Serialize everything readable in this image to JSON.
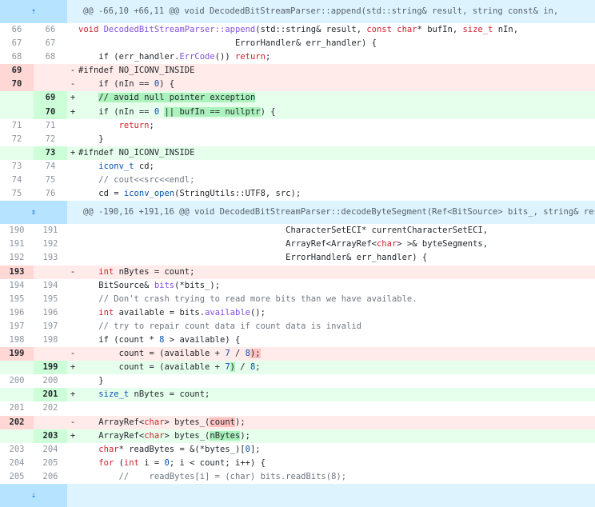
{
  "hunks": [
    {
      "expander_icon": "expand-up-icon",
      "header": "@@ -66,10 +66,11 @@ void DecodedBitStreamParser::append(std::string& result, string const& in,"
    },
    {
      "expander_icon": "expand-both-icon",
      "header": "@@ -190,16 +191,16 @@ void DecodedBitStreamParser::decodeByteSegment(Ref<BitSource> bits_, string& res"
    }
  ],
  "lines": {
    "l1": {
      "old": "66",
      "new": "66",
      "mark": " "
    },
    "l2": {
      "old": "67",
      "new": "67",
      "mark": " "
    },
    "l3": {
      "old": "68",
      "new": "68",
      "mark": " "
    },
    "l4": {
      "old": "69",
      "new": "",
      "mark": "-"
    },
    "l5": {
      "old": "70",
      "new": "",
      "mark": "-"
    },
    "l6": {
      "old": "",
      "new": "69",
      "mark": "+"
    },
    "l7": {
      "old": "",
      "new": "70",
      "mark": "+"
    },
    "l8": {
      "old": "71",
      "new": "71",
      "mark": " "
    },
    "l9": {
      "old": "72",
      "new": "72",
      "mark": " "
    },
    "l10": {
      "old": "",
      "new": "73",
      "mark": "+"
    },
    "l11": {
      "old": "73",
      "new": "74",
      "mark": " "
    },
    "l12": {
      "old": "74",
      "new": "75",
      "mark": " "
    },
    "l13": {
      "old": "75",
      "new": "76",
      "mark": " "
    },
    "m1": {
      "old": "190",
      "new": "191",
      "mark": " "
    },
    "m2": {
      "old": "191",
      "new": "192",
      "mark": " "
    },
    "m3": {
      "old": "192",
      "new": "193",
      "mark": " "
    },
    "m4": {
      "old": "193",
      "new": "",
      "mark": "-"
    },
    "m5": {
      "old": "194",
      "new": "194",
      "mark": " "
    },
    "m6": {
      "old": "195",
      "new": "195",
      "mark": " "
    },
    "m7": {
      "old": "196",
      "new": "196",
      "mark": " "
    },
    "m8": {
      "old": "197",
      "new": "197",
      "mark": " "
    },
    "m9": {
      "old": "198",
      "new": "198",
      "mark": " "
    },
    "m10": {
      "old": "199",
      "new": "",
      "mark": "-"
    },
    "m11": {
      "old": "",
      "new": "199",
      "mark": "+"
    },
    "m12": {
      "old": "200",
      "new": "200",
      "mark": " "
    },
    "m13": {
      "old": "",
      "new": "201",
      "mark": "+"
    },
    "m14": {
      "old": "201",
      "new": "202",
      "mark": " "
    },
    "m15": {
      "old": "202",
      "new": "",
      "mark": "-"
    },
    "m16": {
      "old": "",
      "new": "203",
      "mark": "+"
    },
    "m17": {
      "old": "203",
      "new": "204",
      "mark": " "
    },
    "m18": {
      "old": "204",
      "new": "205",
      "mark": " "
    },
    "m19": {
      "old": "205",
      "new": "206",
      "mark": " "
    }
  },
  "code": {
    "l1a": "void ",
    "l1b": "DecodedBitStreamParser::append",
    "l1c": "(std::string& result, ",
    "l1d": "const char",
    "l1e": "* bufIn, ",
    "l1f": "size_t",
    "l1g": " nIn,",
    "l2": "                               ErrorHandler& err_handler) {",
    "l3a": "    if (err_handler.",
    "l3b": "ErrCode",
    "l3c": "()) ",
    "l3d": "return",
    "l3e": ";",
    "l4": "#ifndef NO_ICONV_INSIDE",
    "l5a": "    if (nIn == ",
    "l5b": "0",
    "l5c": ") {",
    "l6a": "    ",
    "l6b": "// avoid null pointer exception",
    "l7a": "    if (nIn == ",
    "l7b": "0",
    "l7c": " ",
    "l7d": "|| bufIn == nullptr",
    "l7e": ") {",
    "l8a": "        ",
    "l8b": "return",
    "l8c": ";",
    "l9": "    }",
    "l10": "#ifndef NO_ICONV_INSIDE",
    "l11a": "    ",
    "l11b": "iconv_t",
    "l11c": " cd;",
    "l12": "    // cout<<src<<endl;",
    "l13a": "    cd = ",
    "l13b": "iconv_open",
    "l13c": "(StringUtils::UTF8, src);",
    "m1": "                                         CharacterSetECI* currentCharacterSetECI,",
    "m2a": "                                         ArrayRef<ArrayRef<",
    "m2b": "char",
    "m2c": "> >& byteSegments,",
    "m3": "                                         ErrorHandler& err_handler) {",
    "m4a": "    ",
    "m4b": "int",
    "m4c": " nBytes = count;",
    "m5a": "    BitSource& ",
    "m5b": "bits",
    "m5c": "(*bits_);",
    "m6": "    // Don't crash trying to read more bits than we have available.",
    "m7a": "    ",
    "m7b": "int",
    "m7c": " available = bits.",
    "m7d": "available",
    "m7e": "();",
    "m8": "    // try to repair count data if count data is invalid",
    "m9a": "    if (count * ",
    "m9b": "8",
    "m9c": " > available) {",
    "m10a": "        count = (available + ",
    "m10b": "7",
    "m10c": " / ",
    "m10d": "8",
    "m10e": ");",
    "m11a": "        count = (available + ",
    "m11b": "7",
    "m11c": ")",
    "m11d": " / ",
    "m11e": "8",
    "m11f": ";",
    "m12": "    }",
    "m13a": "    ",
    "m13b": "size_t",
    "m13c": " nBytes = count;",
    "m15a": "    ArrayRef<",
    "m15b": "char",
    "m15c": "> bytes_(",
    "m15d": "count",
    "m15e": ");",
    "m16a": "    ArrayRef<",
    "m16b": "char",
    "m16c": "> bytes_(",
    "m16d": "nBytes",
    "m16e": ");",
    "m17a": "    ",
    "m17b": "char",
    "m17c": "* readBytes = &(*bytes_)[",
    "m17d": "0",
    "m17e": "];",
    "m18a": "    ",
    "m18b": "for",
    "m18c": " (",
    "m18d": "int",
    "m18e": " i = ",
    "m18f": "0",
    "m18g": "; i < count; i++) {",
    "m19": "        //    readBytes[i] = (char) bits.readBits(8);"
  },
  "footer": {
    "expander_icon": "expand-down-icon"
  },
  "colors": {
    "deleted_bg": "#ffebe9",
    "added_bg": "#e6ffec",
    "hunk_bg": "#ddf4ff"
  }
}
